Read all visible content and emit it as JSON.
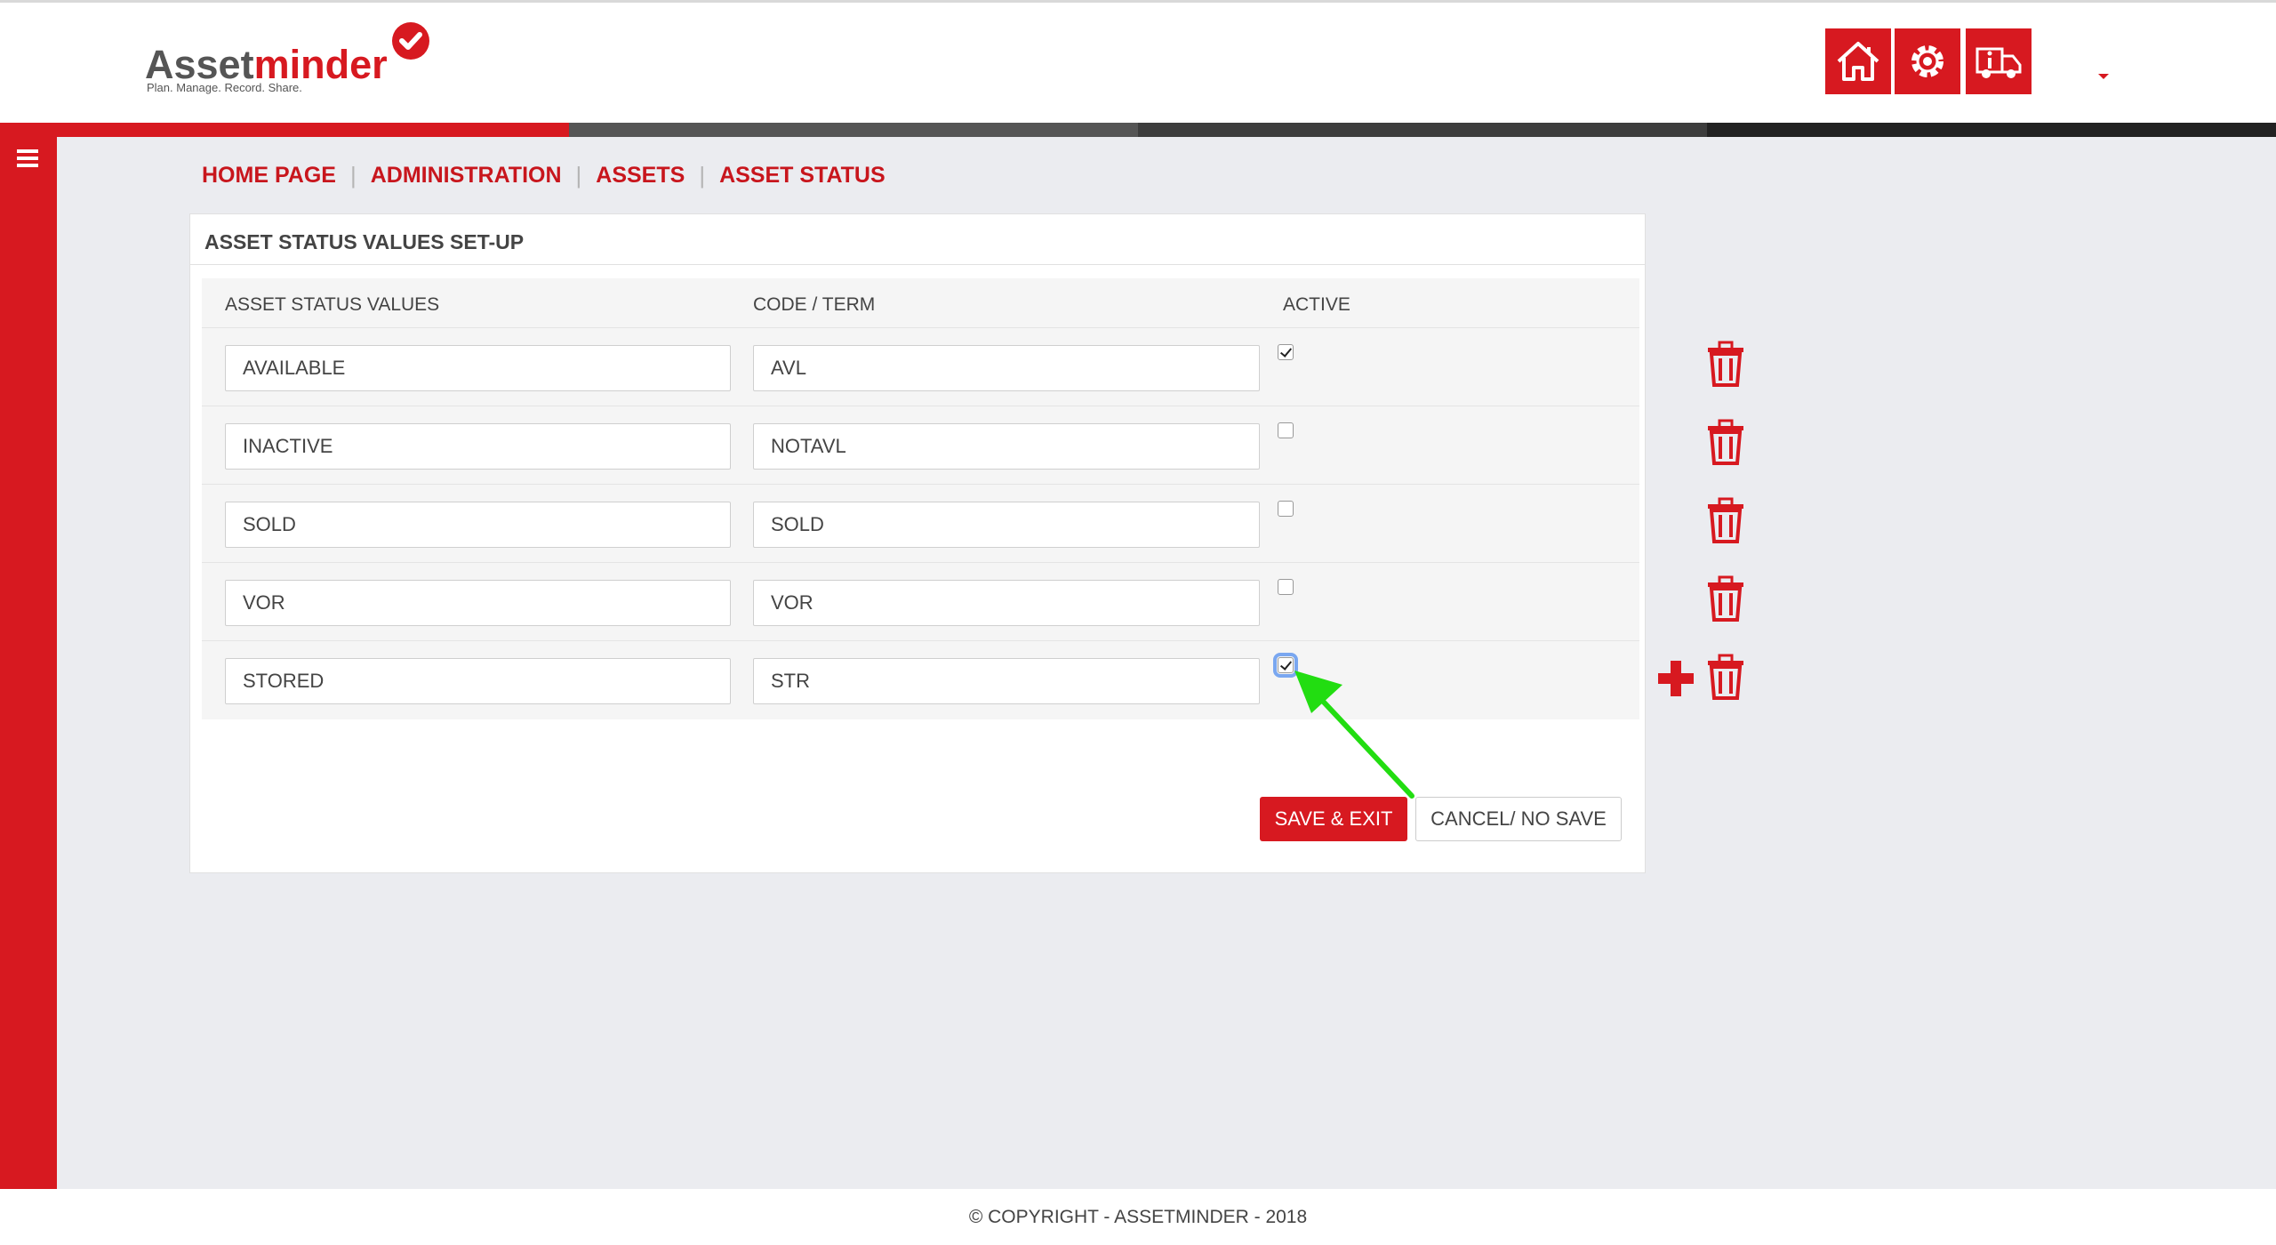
{
  "logo": {
    "part1": "Asset",
    "part2": "minder",
    "tagline": "Plan. Manage. Record. Share."
  },
  "header_buttons": [
    {
      "icon": "home-icon"
    },
    {
      "icon": "settings-icon"
    },
    {
      "icon": "truck-info-icon"
    }
  ],
  "stripe_colors": [
    "#d71920",
    "#555555",
    "#3d3d3d",
    "#222222"
  ],
  "breadcrumb": {
    "items": [
      "HOME PAGE",
      "ADMINISTRATION",
      "ASSETS",
      "ASSET STATUS"
    ],
    "separator": "|"
  },
  "panel": {
    "title": "ASSET STATUS VALUES SET-UP",
    "columns": {
      "value": "ASSET STATUS VALUES",
      "code": "CODE / TERM",
      "active": "ACTIVE"
    },
    "rows": [
      {
        "value": "AVAILABLE",
        "code": "AVL",
        "active": true
      },
      {
        "value": "INACTIVE",
        "code": "NOTAVL",
        "active": false
      },
      {
        "value": "SOLD",
        "code": "SOLD",
        "active": false
      },
      {
        "value": "VOR",
        "code": "VOR",
        "active": false
      },
      {
        "value": "STORED",
        "code": "STR",
        "active": true
      }
    ]
  },
  "buttons": {
    "save": "SAVE & EXIT",
    "cancel": "CANCEL/ NO SAVE"
  },
  "footer": {
    "text": "© COPYRIGHT - ASSETMINDER - 2018"
  },
  "colors": {
    "brand_red": "#d71920",
    "link_red": "#c8161d",
    "background": "#ebecf0",
    "annotation_arrow": "#22dd11"
  }
}
